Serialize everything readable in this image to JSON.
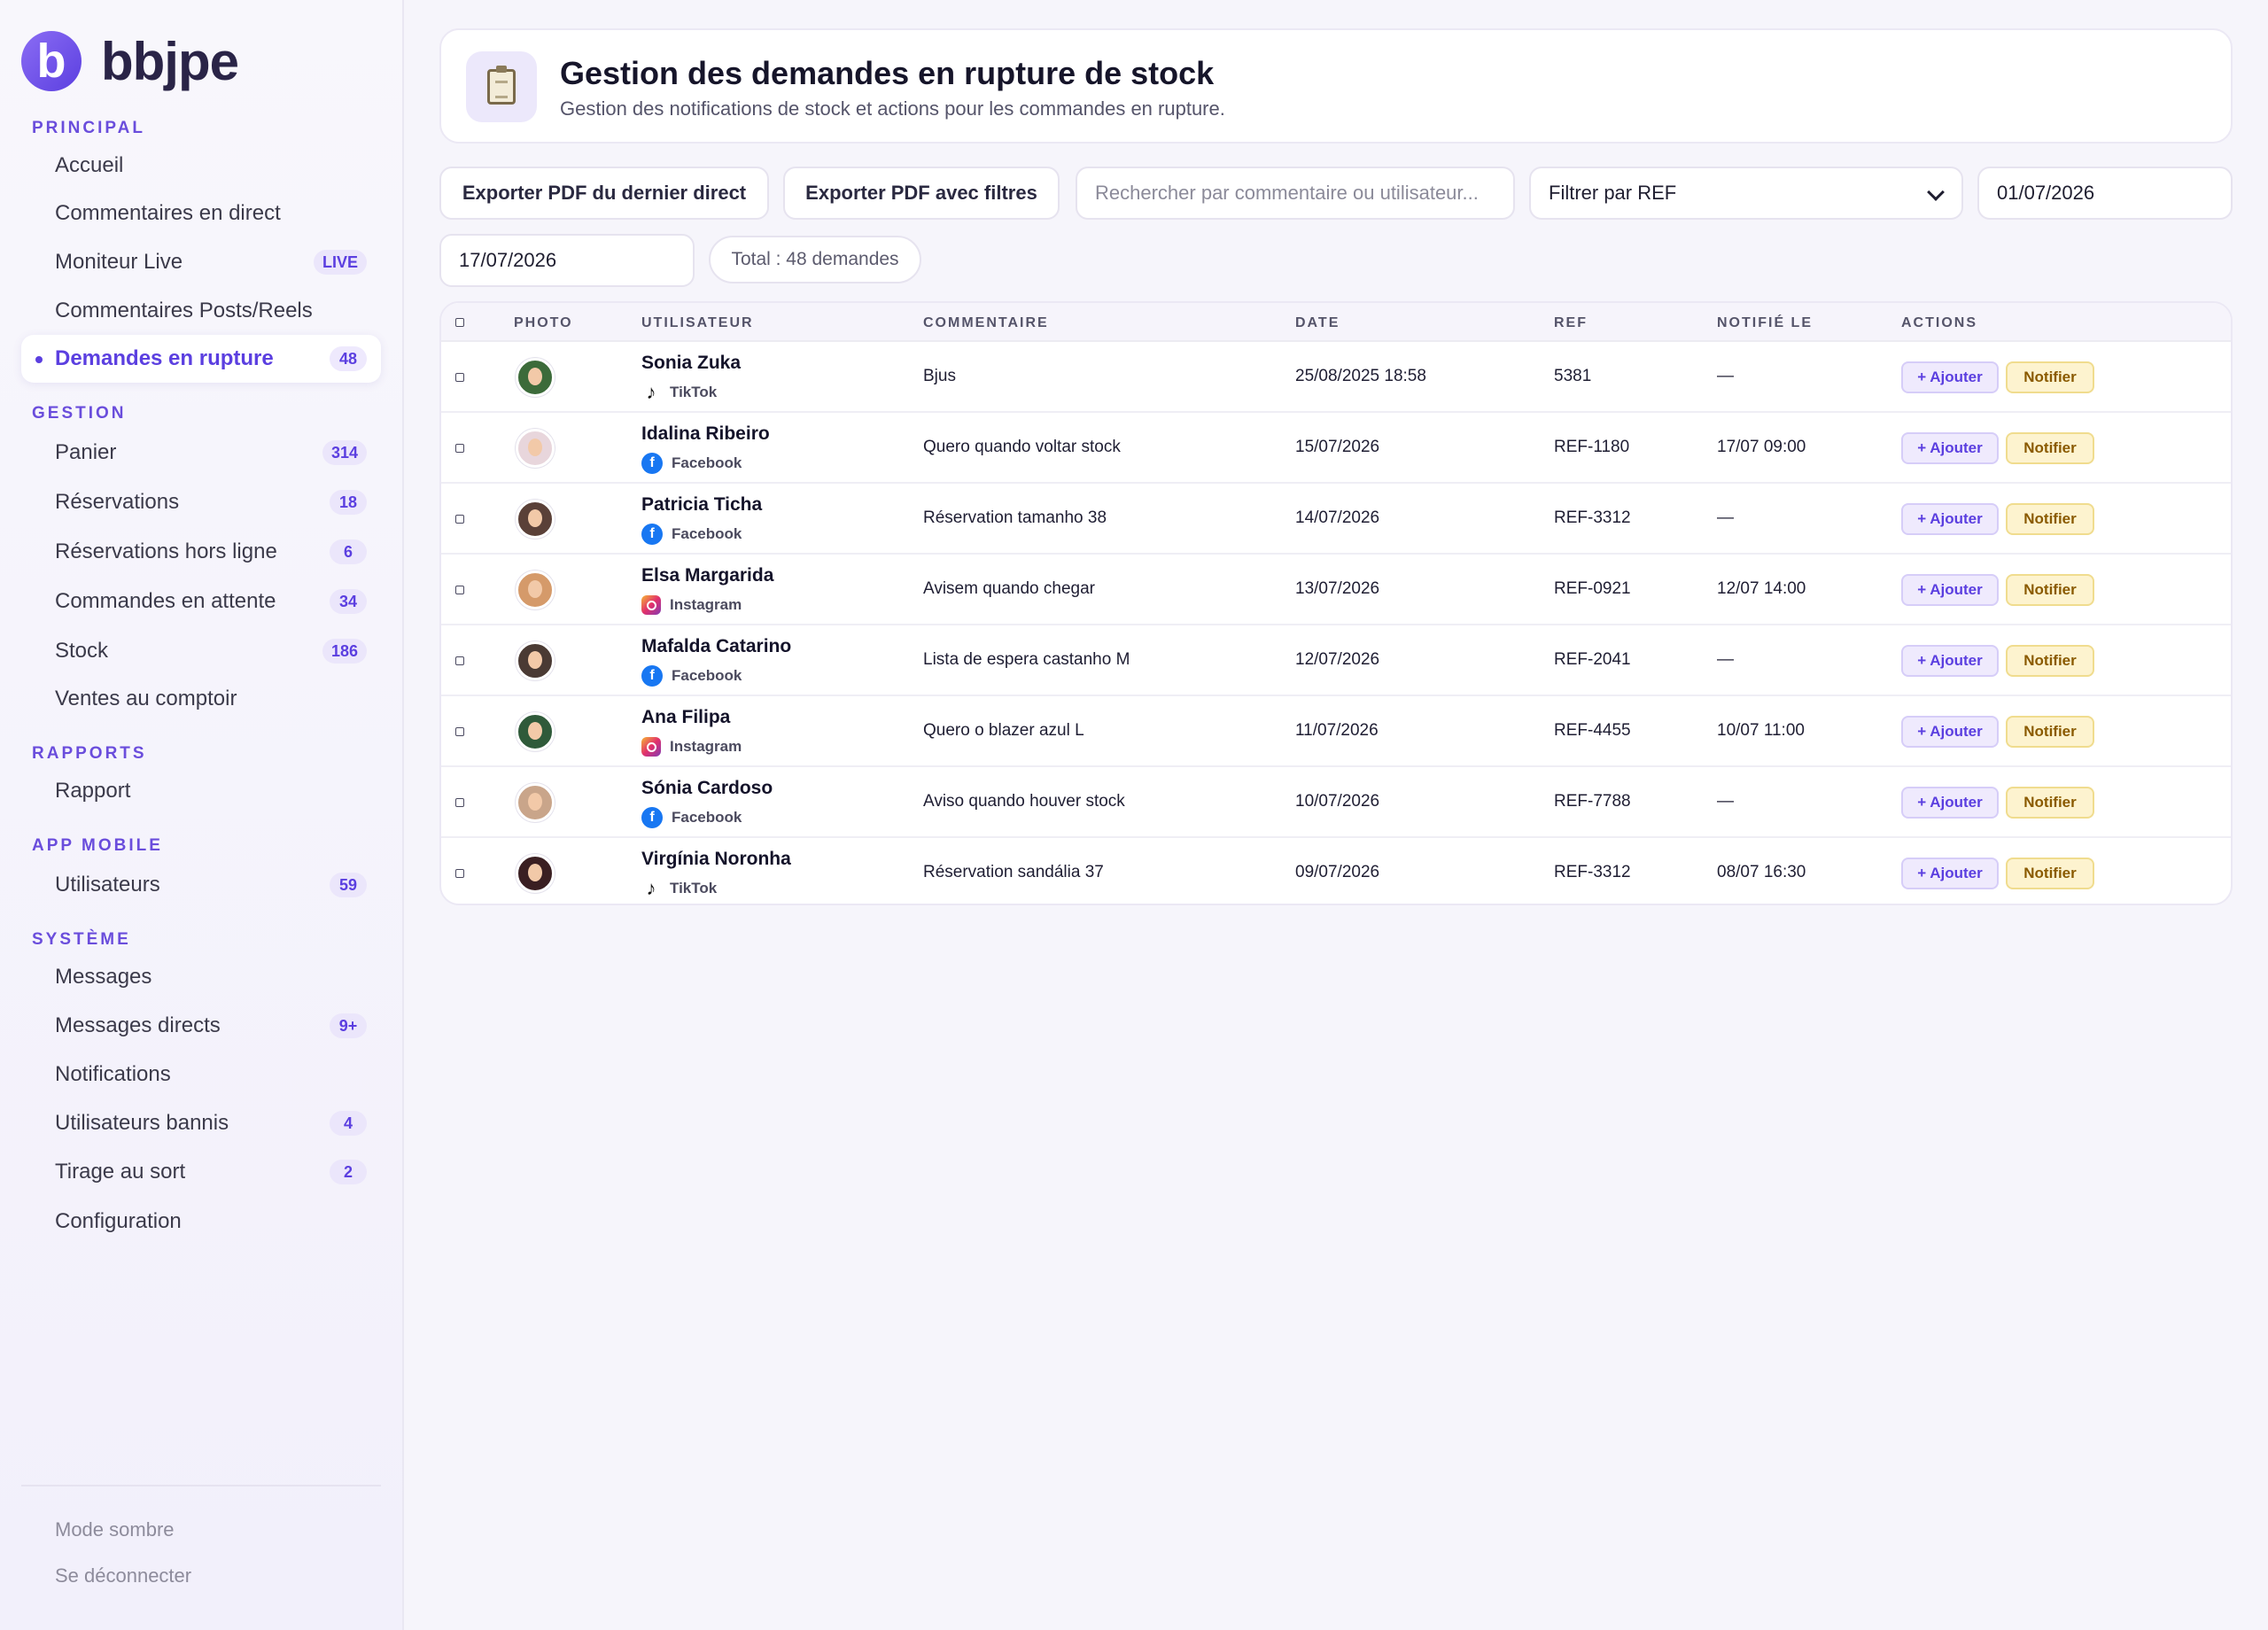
{
  "brand": {
    "logo_letter": "b",
    "name": "bbjpe"
  },
  "sidebar": {
    "sections": [
      {
        "title": "PRINCIPAL"
      },
      {
        "title": "GESTION"
      },
      {
        "title": "RAPPORTS"
      },
      {
        "title": "APP MOBILE"
      },
      {
        "title": "SYSTÈME"
      }
    ],
    "items": [
      {
        "label": "Accueil"
      },
      {
        "label": "Commentaires en direct"
      },
      {
        "label": "Moniteur Live",
        "badge": "LIVE"
      },
      {
        "label": "Commentaires Posts/Reels"
      },
      {
        "label": "Demandes en rupture",
        "badge": "48",
        "active": true
      },
      {
        "label": "Panier",
        "badge": "314"
      },
      {
        "label": "Réservations",
        "badge": "18"
      },
      {
        "label": "Réservations hors ligne",
        "badge": "6"
      },
      {
        "label": "Commandes en attente",
        "badge": "34"
      },
      {
        "label": "Stock",
        "badge": "186"
      },
      {
        "label": "Ventes au comptoir"
      },
      {
        "label": "Rapport"
      },
      {
        "label": "Utilisateurs",
        "badge": "59"
      },
      {
        "label": "Messages"
      },
      {
        "label": "Messages directs",
        "badge": "9+"
      },
      {
        "label": "Notifications"
      },
      {
        "label": "Utilisateurs bannis",
        "badge": "4"
      },
      {
        "label": "Tirage au sort",
        "badge": "2"
      },
      {
        "label": "Configuration"
      }
    ],
    "footer": {
      "dark_mode": "Mode sombre",
      "logout": "Se déconnecter"
    }
  },
  "header": {
    "icon": "clipboard-icon",
    "title": "Gestion des demandes en rupture de stock",
    "subtitle": "Gestion des notifications de stock et actions pour les commandes en rupture."
  },
  "toolbar": {
    "export_last_live": "Exporter PDF du dernier direct",
    "export_filtered": "Exporter PDF avec filtres",
    "search_placeholder": "Rechercher par commentaire ou utilisateur...",
    "ref_filter": "Filtrer par REF",
    "date_from": "01/07/2026",
    "date_to": "17/07/2026",
    "total": "Total : 48 demandes"
  },
  "table": {
    "columns": {
      "photo": "PHOTO",
      "user": "UTILISATEUR",
      "comment": "COMMENTAIRE",
      "date": "DATE",
      "ref": "REF",
      "notified": "NOTIFIÉ LE",
      "actions": "ACTIONS"
    },
    "add_label": "+ Ajouter",
    "notify_label": "Notifier",
    "rows": [
      {
        "name": "Sonia Zuka",
        "platform": "TikTok",
        "comment": "Bjus",
        "date": "25/08/2025 18:58",
        "ref": "5381",
        "notified": "—"
      },
      {
        "name": "Idalina Ribeiro",
        "platform": "Facebook",
        "comment": "Quero quando voltar stock",
        "date": "15/07/2026",
        "ref": "REF-1180",
        "notified": "17/07 09:00"
      },
      {
        "name": "Patricia Ticha",
        "platform": "Facebook",
        "comment": "Réservation tamanho 38",
        "date": "14/07/2026",
        "ref": "REF-3312",
        "notified": "—"
      },
      {
        "name": "Elsa Margarida",
        "platform": "Instagram",
        "comment": "Avisem quando chegar",
        "date": "13/07/2026",
        "ref": "REF-0921",
        "notified": "12/07 14:00"
      },
      {
        "name": "Mafalda Catarino",
        "platform": "Facebook",
        "comment": "Lista de espera castanho M",
        "date": "12/07/2026",
        "ref": "REF-2041",
        "notified": "—"
      },
      {
        "name": "Ana Filipa",
        "platform": "Instagram",
        "comment": "Quero o blazer azul L",
        "date": "11/07/2026",
        "ref": "REF-4455",
        "notified": "10/07 11:00"
      },
      {
        "name": "Sónia Cardoso",
        "platform": "Facebook",
        "comment": "Aviso quando houver stock",
        "date": "10/07/2026",
        "ref": "REF-7788",
        "notified": "—"
      },
      {
        "name": "Virgínia Noronha",
        "platform": "TikTok",
        "comment": "Réservation sandália 37",
        "date": "09/07/2026",
        "ref": "REF-3312",
        "notified": "08/07 16:30"
      }
    ]
  }
}
